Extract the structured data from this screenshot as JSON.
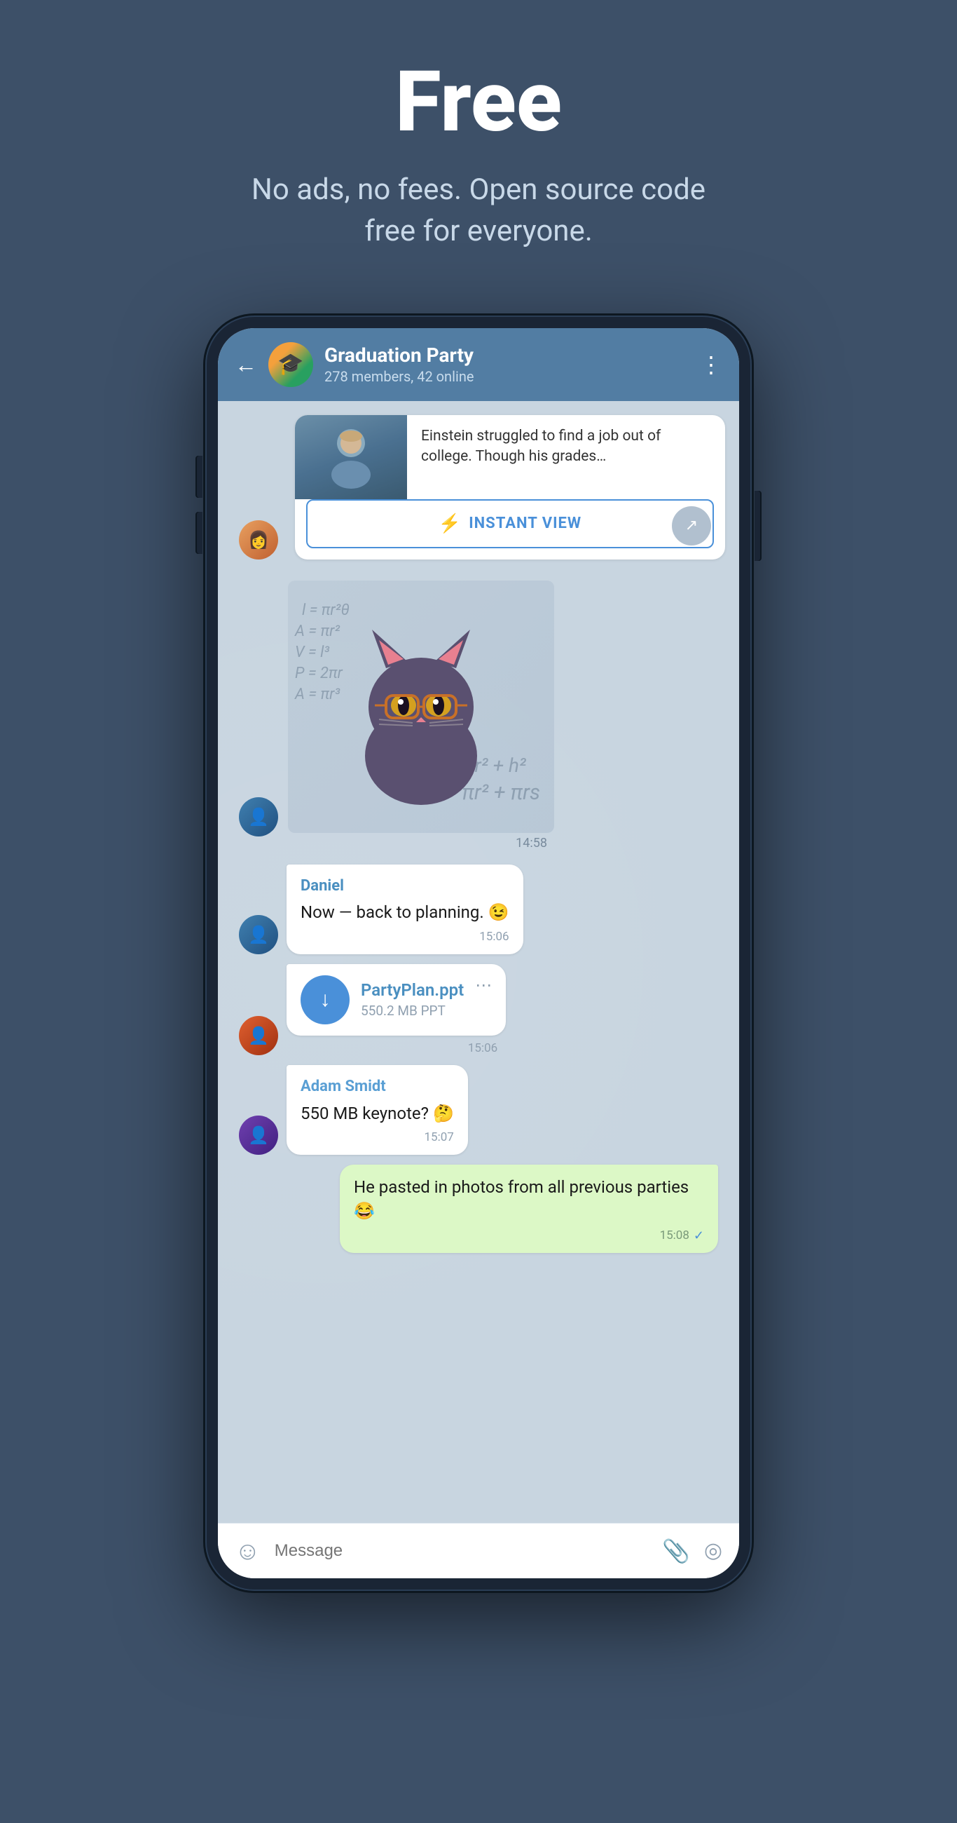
{
  "hero": {
    "title": "Free",
    "subtitle": "No ads, no fees. Open source code free for everyone."
  },
  "chat": {
    "header": {
      "group_name": "Graduation Party",
      "status": "278 members, 42 online",
      "back_label": "←",
      "more_label": "⋮"
    },
    "article": {
      "text": "Einstein struggled to find a job out of college. Though his grades…",
      "instant_view_label": "INSTANT VIEW",
      "instant_view_icon": "⚡"
    },
    "sticker": {
      "time": "14:58"
    },
    "messages": [
      {
        "id": "msg1",
        "sender": "Daniel",
        "sender_color": "#4a8fc0",
        "text": "Now — back to planning. 😉",
        "time": "15:06",
        "side": "left",
        "avatar": "guy-blue"
      },
      {
        "id": "msg2",
        "type": "file",
        "file_name": "PartyPlan.ppt",
        "file_size": "550.2 MB PPT",
        "time": "15:06",
        "side": "left",
        "avatar": "guy-orange"
      },
      {
        "id": "msg3",
        "sender": "Adam Smidt",
        "sender_color": "#5a9fd4",
        "text": "550 MB keynote? 🤔",
        "time": "15:07",
        "side": "left",
        "avatar": "guy-purple"
      },
      {
        "id": "msg4",
        "text": "He pasted in photos from all previous parties 😂",
        "time": "15:08",
        "side": "right",
        "check": "✓"
      }
    ],
    "input": {
      "placeholder": "Message",
      "emoji_icon": "☺",
      "attach_icon": "📎",
      "camera_icon": "⊙"
    }
  },
  "math_formulas": [
    "l = πr²θ",
    "A = πr²",
    "V = l³",
    "P = 2πr",
    "A = πr³",
    "s = √(r² + h²)",
    "A = πr² + πrs"
  ]
}
